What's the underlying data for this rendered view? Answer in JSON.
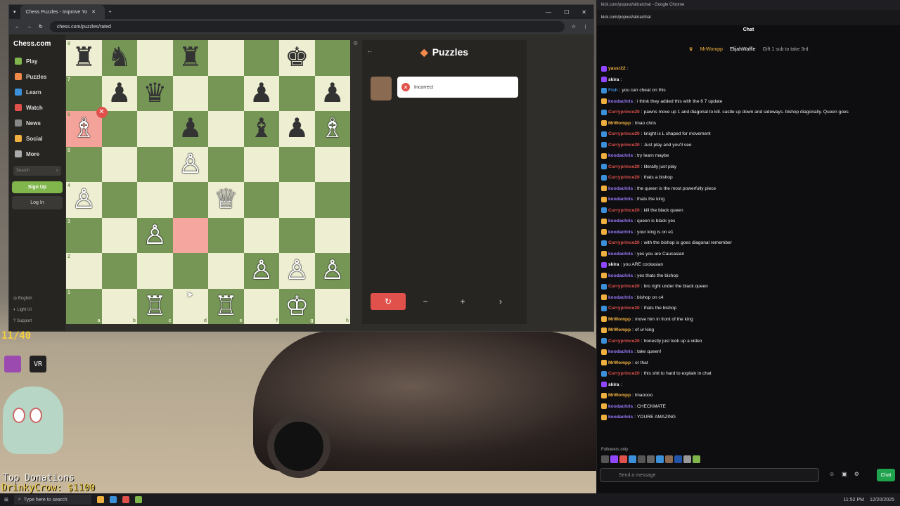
{
  "browser": {
    "tab_title": "Chess Puzzles - Improve Yo",
    "url": "chess.com/puzzles/rated"
  },
  "sidebar": {
    "logo": "Chess.com",
    "items": [
      {
        "label": "Play",
        "color": "#81b64c"
      },
      {
        "label": "Puzzles",
        "color": "#f08a4b"
      },
      {
        "label": "Learn",
        "color": "#3c8fd9"
      },
      {
        "label": "Watch",
        "color": "#e0514b"
      },
      {
        "label": "News",
        "color": "#888888"
      },
      {
        "label": "Social",
        "color": "#f0b040"
      },
      {
        "label": "More",
        "color": "#aaaaaa"
      }
    ],
    "search_placeholder": "Search",
    "signup": "Sign Up",
    "login": "Log In",
    "footer": [
      "English",
      "Light UI",
      "Support"
    ]
  },
  "board": {
    "ranks": [
      "8",
      "7",
      "6",
      "5",
      "4",
      "3",
      "2",
      "1"
    ],
    "files": [
      "a",
      "b",
      "c",
      "d",
      "e",
      "f",
      "g",
      "h"
    ],
    "highlights": {
      "a6": "hl",
      "d3": "hl2"
    },
    "wrong_square": "a6",
    "pieces": {
      "a8": "♜",
      "b8": "♞",
      "d8": "♜",
      "g8": "♚",
      "b7": "♟",
      "c7": "♛",
      "f7": "♟",
      "h7": "♟",
      "a6": "♗",
      "d6": "♟",
      "f6": "♝",
      "g6": "♟",
      "h6": "♗",
      "d5": "♙",
      "a4": "♙",
      "e4": "♕",
      "c3": "♙",
      "f2": "♙",
      "g2": "♙",
      "h2": "♙",
      "c1": "♖",
      "e1": "♖",
      "g1": "♔"
    },
    "white_squares": [
      "a6",
      "h6",
      "d5",
      "a4",
      "e4",
      "c3",
      "f2",
      "g2",
      "h2",
      "c1",
      "e1",
      "g1"
    ]
  },
  "panel": {
    "title": "Puzzles",
    "feedback": "Incorrect",
    "buttons": [
      "↻",
      "−",
      "+",
      "›"
    ]
  },
  "overlay": {
    "timer": "11/40",
    "donations_title": "Top Donations",
    "donation": "DrinkyCrow: $1100"
  },
  "taskbar": {
    "search": "Type here to search",
    "time": "11:52 PM",
    "date": "12/20/2025"
  },
  "chat": {
    "window_title": "kick.com/popout/skira/chat - Google Chrome",
    "url": "kick.com/popout/skira/chat",
    "header": "Chat",
    "pinned_users": [
      "MrWompp",
      "ElijahWaffle"
    ],
    "pinned_sub": "Gift 1 sub to take 3rd",
    "followers_only": "Followers only",
    "input_placeholder": "Send a message",
    "send_button": "Chat",
    "messages": [
      {
        "user": "yassr22",
        "text": "",
        "color": "#f0b040",
        "badge": "#9147ff"
      },
      {
        "user": "skira",
        "text": "",
        "color": "#ffffff",
        "badge": "#9147ff"
      },
      {
        "user": "Fish",
        "text": "you can cheat on this",
        "color": "#3c8fd9",
        "badge": "#3c8fd9"
      },
      {
        "user": "koodachris",
        "text": "i think they added this with the 6 7 update",
        "color": "#9b7bff",
        "badge": "#f0b040"
      },
      {
        "user": "Curryprince20",
        "text": "pawns move up 1 and diagonal to kill. castle up down and sideways. bishop diagonally. Queen goes",
        "color": "#e0514b",
        "badge": "#3c8fd9"
      },
      {
        "user": "MrWompp",
        "text": "lmao chris",
        "color": "#f0b040",
        "badge": "#f0b040"
      },
      {
        "user": "Curryprince20",
        "text": "knight is L shaped for movement",
        "color": "#e0514b",
        "badge": "#3c8fd9"
      },
      {
        "user": "Curryprince20",
        "text": "Just play and you'll see",
        "color": "#e0514b",
        "badge": "#3c8fd9"
      },
      {
        "user": "koodachris",
        "text": "try learn maybe",
        "color": "#9b7bff",
        "badge": "#f0b040"
      },
      {
        "user": "Curryprince20",
        "text": "literally just play",
        "color": "#e0514b",
        "badge": "#3c8fd9"
      },
      {
        "user": "Curryprince20",
        "text": "thats a bishop",
        "color": "#e0514b",
        "badge": "#3c8fd9"
      },
      {
        "user": "koodachris",
        "text": "the queen is the most powerfully piece",
        "color": "#9b7bff",
        "badge": "#f0b040"
      },
      {
        "user": "koodachris",
        "text": "thats the king",
        "color": "#9b7bff",
        "badge": "#f0b040"
      },
      {
        "user": "Curryprince20",
        "text": "kill the black queen",
        "color": "#e0514b",
        "badge": "#3c8fd9"
      },
      {
        "user": "koodachris",
        "text": "queen is black yes",
        "color": "#9b7bff",
        "badge": "#f0b040"
      },
      {
        "user": "koodachris",
        "text": "your king is on e1",
        "color": "#9b7bff",
        "badge": "#f0b040"
      },
      {
        "user": "Curryprince20",
        "text": "with the bishop is goes diagonal remember",
        "color": "#e0514b",
        "badge": "#3c8fd9"
      },
      {
        "user": "koodachris",
        "text": "yes you are Caucasian",
        "color": "#9b7bff",
        "badge": "#f0b040"
      },
      {
        "user": "skira",
        "text": "you ARE cockasian",
        "color": "#ffffff",
        "badge": "#9147ff"
      },
      {
        "user": "koodachris",
        "text": "yes thats the bishop",
        "color": "#9b7bff",
        "badge": "#f0b040"
      },
      {
        "user": "Curryprince20",
        "text": "bro right under the black queen",
        "color": "#e0514b",
        "badge": "#3c8fd9"
      },
      {
        "user": "koodachris",
        "text": "bishop on c4",
        "color": "#9b7bff",
        "badge": "#f0b040"
      },
      {
        "user": "Curryprince20",
        "text": "thats the bishop",
        "color": "#e0514b",
        "badge": "#3c8fd9"
      },
      {
        "user": "MrWompp",
        "text": "move him in front of the king",
        "color": "#f0b040",
        "badge": "#f0b040"
      },
      {
        "user": "MrWompp",
        "text": "of ur king",
        "color": "#f0b040",
        "badge": "#f0b040"
      },
      {
        "user": "Curryprince20",
        "text": "honestly just look up a video",
        "color": "#e0514b",
        "badge": "#3c8fd9"
      },
      {
        "user": "koodachris",
        "text": "take queen!",
        "color": "#9b7bff",
        "badge": "#f0b040"
      },
      {
        "user": "MrWompp",
        "text": "or that",
        "color": "#f0b040",
        "badge": "#f0b040"
      },
      {
        "user": "Curryprince20",
        "text": "this shit to hard to explain in chat",
        "color": "#e0514b",
        "badge": "#3c8fd9"
      },
      {
        "user": "skira",
        "text": "",
        "color": "#ffffff",
        "badge": "#9147ff"
      },
      {
        "user": "MrWompp",
        "text": "lmaoooo",
        "color": "#f0b040",
        "badge": "#f0b040"
      },
      {
        "user": "koodachris",
        "text": "CHECKMATE",
        "color": "#9b7bff",
        "badge": "#f0b040"
      },
      {
        "user": "koodachris",
        "text": "YOURE AMAZING",
        "color": "#9b7bff",
        "badge": "#f0b040"
      }
    ]
  }
}
